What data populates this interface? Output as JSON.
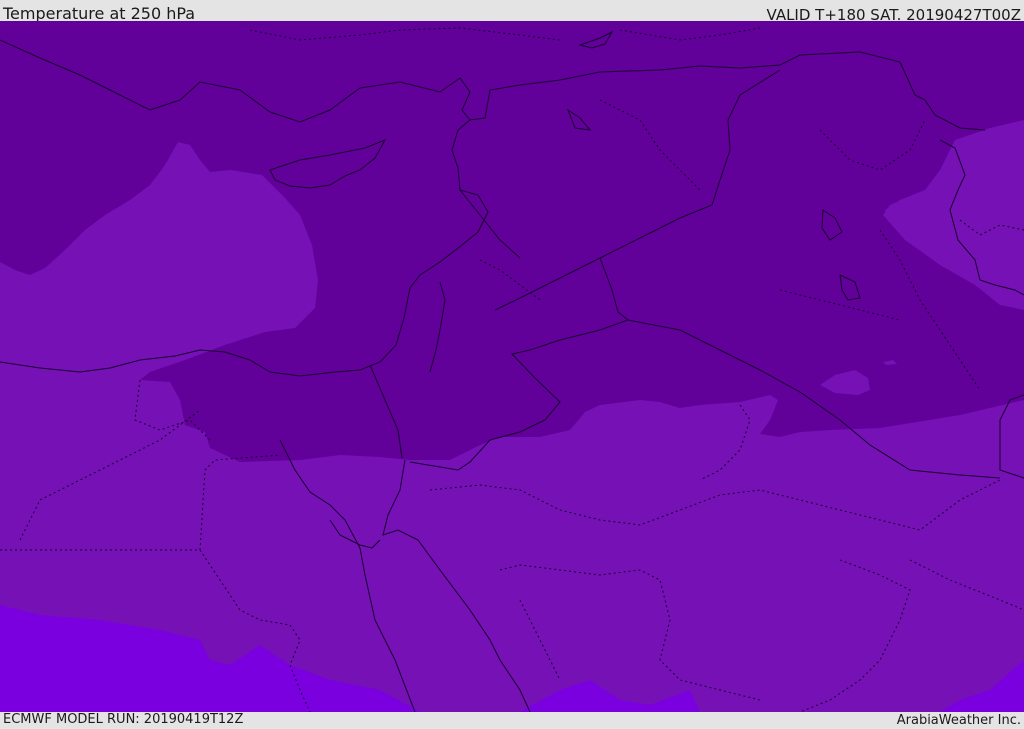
{
  "header": {
    "title": "Temperature at 250 hPa",
    "valid": "VALID T+180 SAT. 20190427T00Z"
  },
  "footer": {
    "model_run": "ECMWF MODEL RUN: 20190419T12Z",
    "credit": "ArabiaWeather Inc."
  },
  "map": {
    "field": "temperature",
    "level": "250 hPa",
    "palette": {
      "coldest": "#62009a",
      "cold": "#7511b5",
      "mild": "#7a00df",
      "boundary": "#1a0030"
    }
  }
}
